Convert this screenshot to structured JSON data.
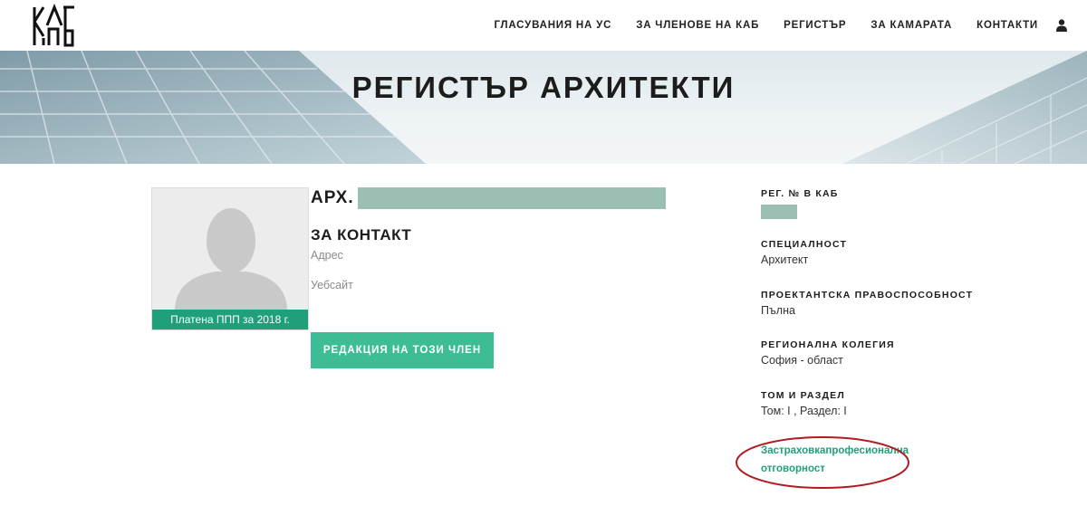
{
  "header": {
    "logo_alt": "КАБ",
    "nav": [
      {
        "label": "ГЛАСУВАНИЯ НА УС"
      },
      {
        "label": "ЗА ЧЛЕНОВЕ НА КАБ"
      },
      {
        "label": "РЕГИСТЪР"
      },
      {
        "label": "ЗА КАМАРАТА"
      },
      {
        "label": "КОНТАКТИ"
      }
    ],
    "user_icon": "user-icon"
  },
  "banner": {
    "title": "РЕГИСТЪР АРХИТЕКТИ"
  },
  "profile": {
    "photo_label": "Платена ППП за 2018 г.",
    "name_prefix": "АРХ.",
    "contact_heading": "ЗА КОНТАКТ",
    "address_label": "Адрес",
    "website_label": "Уебсайт",
    "edit_button": "РЕДАКЦИЯ НА ТОЗИ ЧЛЕН"
  },
  "details": {
    "reg_label": "РЕГ. № В КАБ",
    "specialty_label": "СПЕЦИАЛНОСТ",
    "specialty_value": "Архитект",
    "capacity_label": "ПРОЕКТАНТСКА ПРАВОСПОСОБНОСТ",
    "capacity_value": "Пълна",
    "college_label": "РЕГИОНАЛНА КОЛЕГИЯ",
    "college_value": "София - област",
    "volume_label": "ТОМ И РАЗДЕЛ",
    "volume_value": "Том: I , Раздел: I",
    "insurance_link": "Застраховкапрофесионална отговорност"
  },
  "colors": {
    "accent": "#3dbd96",
    "accent_dark": "#1fa07a",
    "redaction": "#9bbfb2",
    "annotation": "#b01c22"
  }
}
